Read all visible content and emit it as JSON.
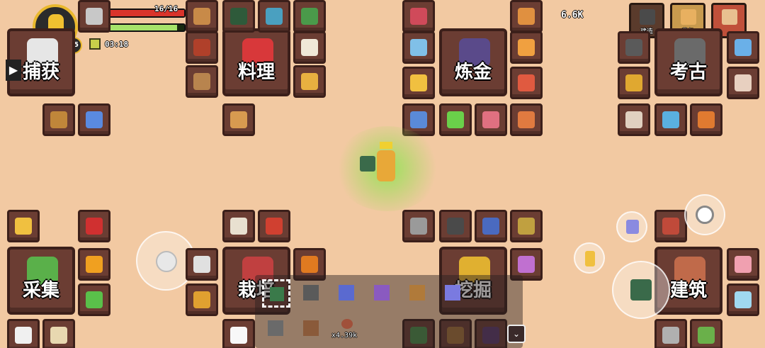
{
  "player": {
    "level": "65",
    "hp_text": "16/16",
    "hp_fraction": 1.0,
    "xp_fraction": 0.92,
    "timer": "03:18"
  },
  "currency": {
    "amount": "6.6K"
  },
  "top_buttons": [
    {
      "label": "建造",
      "icon": "build-icon"
    },
    {
      "label": "背包",
      "icon": "backpack-icon"
    },
    {
      "label": "",
      "icon": "journal-icon"
    }
  ],
  "stations": {
    "capture": "捕获",
    "cooking": "料理",
    "alchemy": "炼金",
    "archaeology": "考古",
    "gather": "采集",
    "farming": "栽培",
    "mining": "挖掘",
    "building": "建筑"
  },
  "toolbar": {
    "count_text": "x4.39k"
  },
  "colors": {
    "ground": "#f2c9a2",
    "slot": "#6b3d33",
    "hp": "#d9342b",
    "xp": "#7fd34a"
  }
}
